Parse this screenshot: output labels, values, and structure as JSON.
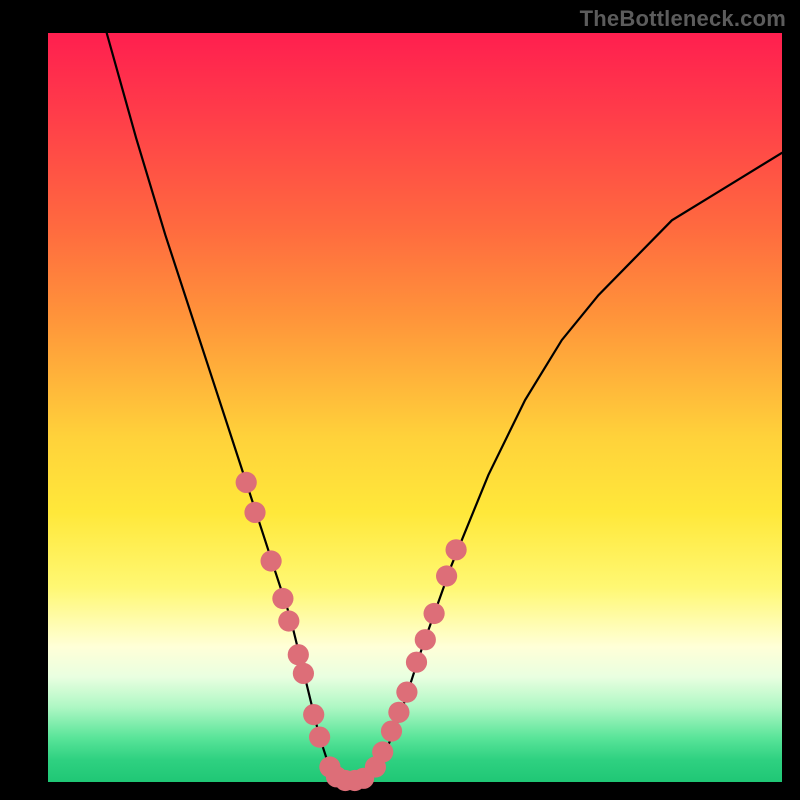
{
  "watermark": "TheBottleneck.com",
  "chart_data": {
    "type": "line",
    "title": "",
    "xlabel": "",
    "ylabel": "",
    "xlim": [
      0,
      100
    ],
    "ylim": [
      0,
      100
    ],
    "series": [
      {
        "name": "curve",
        "color": "#000000",
        "x": [
          8,
          12,
          16,
          20,
          24,
          27,
          29,
          31,
          33,
          35,
          36,
          37,
          38,
          39,
          40,
          42,
          44,
          46,
          48,
          51,
          55,
          60,
          65,
          70,
          75,
          80,
          85,
          90,
          95,
          100
        ],
        "y": [
          100,
          86,
          73,
          61,
          49,
          40,
          34,
          28,
          22,
          14,
          10,
          6,
          3,
          1,
          0,
          0,
          1,
          4,
          9,
          18,
          29,
          41,
          51,
          59,
          65,
          70,
          75,
          78,
          81,
          84
        ]
      }
    ],
    "markers": {
      "name": "bead-markers",
      "color": "#dd6e78",
      "radius_pct": 1.45,
      "points": [
        {
          "x": 27.0,
          "y": 40.0
        },
        {
          "x": 28.2,
          "y": 36.0
        },
        {
          "x": 30.4,
          "y": 29.5
        },
        {
          "x": 32.0,
          "y": 24.5
        },
        {
          "x": 32.8,
          "y": 21.5
        },
        {
          "x": 34.1,
          "y": 17.0
        },
        {
          "x": 34.8,
          "y": 14.5
        },
        {
          "x": 36.2,
          "y": 9.0
        },
        {
          "x": 37.0,
          "y": 6.0
        },
        {
          "x": 38.4,
          "y": 2.0
        },
        {
          "x": 39.3,
          "y": 0.7
        },
        {
          "x": 40.5,
          "y": 0.2
        },
        {
          "x": 41.8,
          "y": 0.2
        },
        {
          "x": 43.0,
          "y": 0.5
        },
        {
          "x": 44.6,
          "y": 2.0
        },
        {
          "x": 45.6,
          "y": 4.0
        },
        {
          "x": 46.8,
          "y": 6.8
        },
        {
          "x": 47.8,
          "y": 9.3
        },
        {
          "x": 48.9,
          "y": 12.0
        },
        {
          "x": 50.2,
          "y": 16.0
        },
        {
          "x": 51.4,
          "y": 19.0
        },
        {
          "x": 52.6,
          "y": 22.5
        },
        {
          "x": 54.3,
          "y": 27.5
        },
        {
          "x": 55.6,
          "y": 31.0
        }
      ]
    },
    "background_gradient": {
      "top_color": "#ff1f4f",
      "mid_color": "#ffe83a",
      "bottom_color": "#1fc775"
    }
  }
}
